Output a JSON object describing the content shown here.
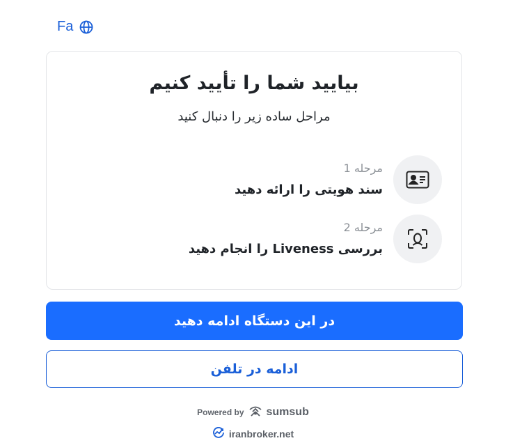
{
  "language": {
    "label": "Fa",
    "icon": "globe-icon"
  },
  "card": {
    "title": "بیایید شما را تأیید کنیم",
    "subtitle": "مراحل ساده زیر را دنبال کنید",
    "steps": [
      {
        "number": "مرحله 1",
        "label": "سند هویتی را ارائه دهید",
        "icon": "id-card-icon"
      },
      {
        "number": "مرحله 2",
        "label": "بررسی Liveness را انجام دهید",
        "icon": "face-scan-icon"
      }
    ]
  },
  "buttons": {
    "continue_device": "در این دستگاه ادامه دهید",
    "continue_phone": "ادامه در تلفن"
  },
  "footer": {
    "powered_by": "Powered by",
    "brand": "sumsub",
    "site": "iranbroker.net"
  },
  "colors": {
    "primary": "#1a6dff",
    "link": "#1a5fd8",
    "icon_bg": "#f0f1f3"
  }
}
